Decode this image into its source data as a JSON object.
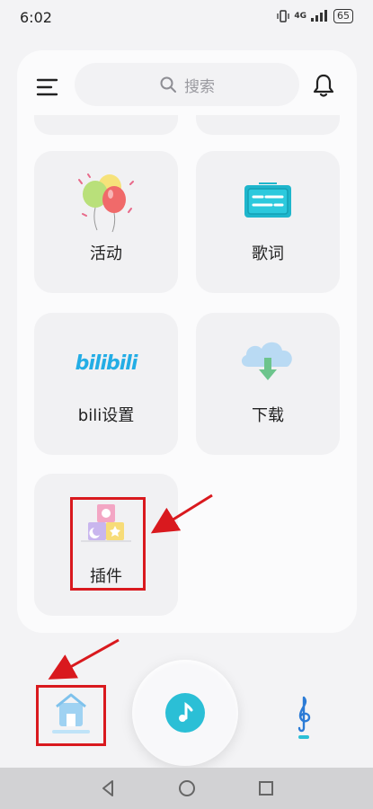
{
  "status_bar": {
    "time": "6:02",
    "network": "4G",
    "battery": "65"
  },
  "top_bar": {
    "search_placeholder": "搜索"
  },
  "cards": [
    {
      "label": "活动",
      "icon": "balloons-icon"
    },
    {
      "label": "歌词",
      "icon": "lyrics-icon"
    },
    {
      "label": "bili设置",
      "icon": "bilibili-logo"
    },
    {
      "label": "下载",
      "icon": "cloud-download-icon"
    },
    {
      "label": "插件",
      "icon": "blocks-icon"
    }
  ],
  "bilibili_logo_text": "bilibili",
  "bottom_nav": {
    "items": [
      "home-icon",
      "player-button",
      "music-note-icon"
    ]
  },
  "colors": {
    "accent": "#2bbfd6",
    "annotation": "#d9191e",
    "card_bg": "#f1f1f3"
  }
}
